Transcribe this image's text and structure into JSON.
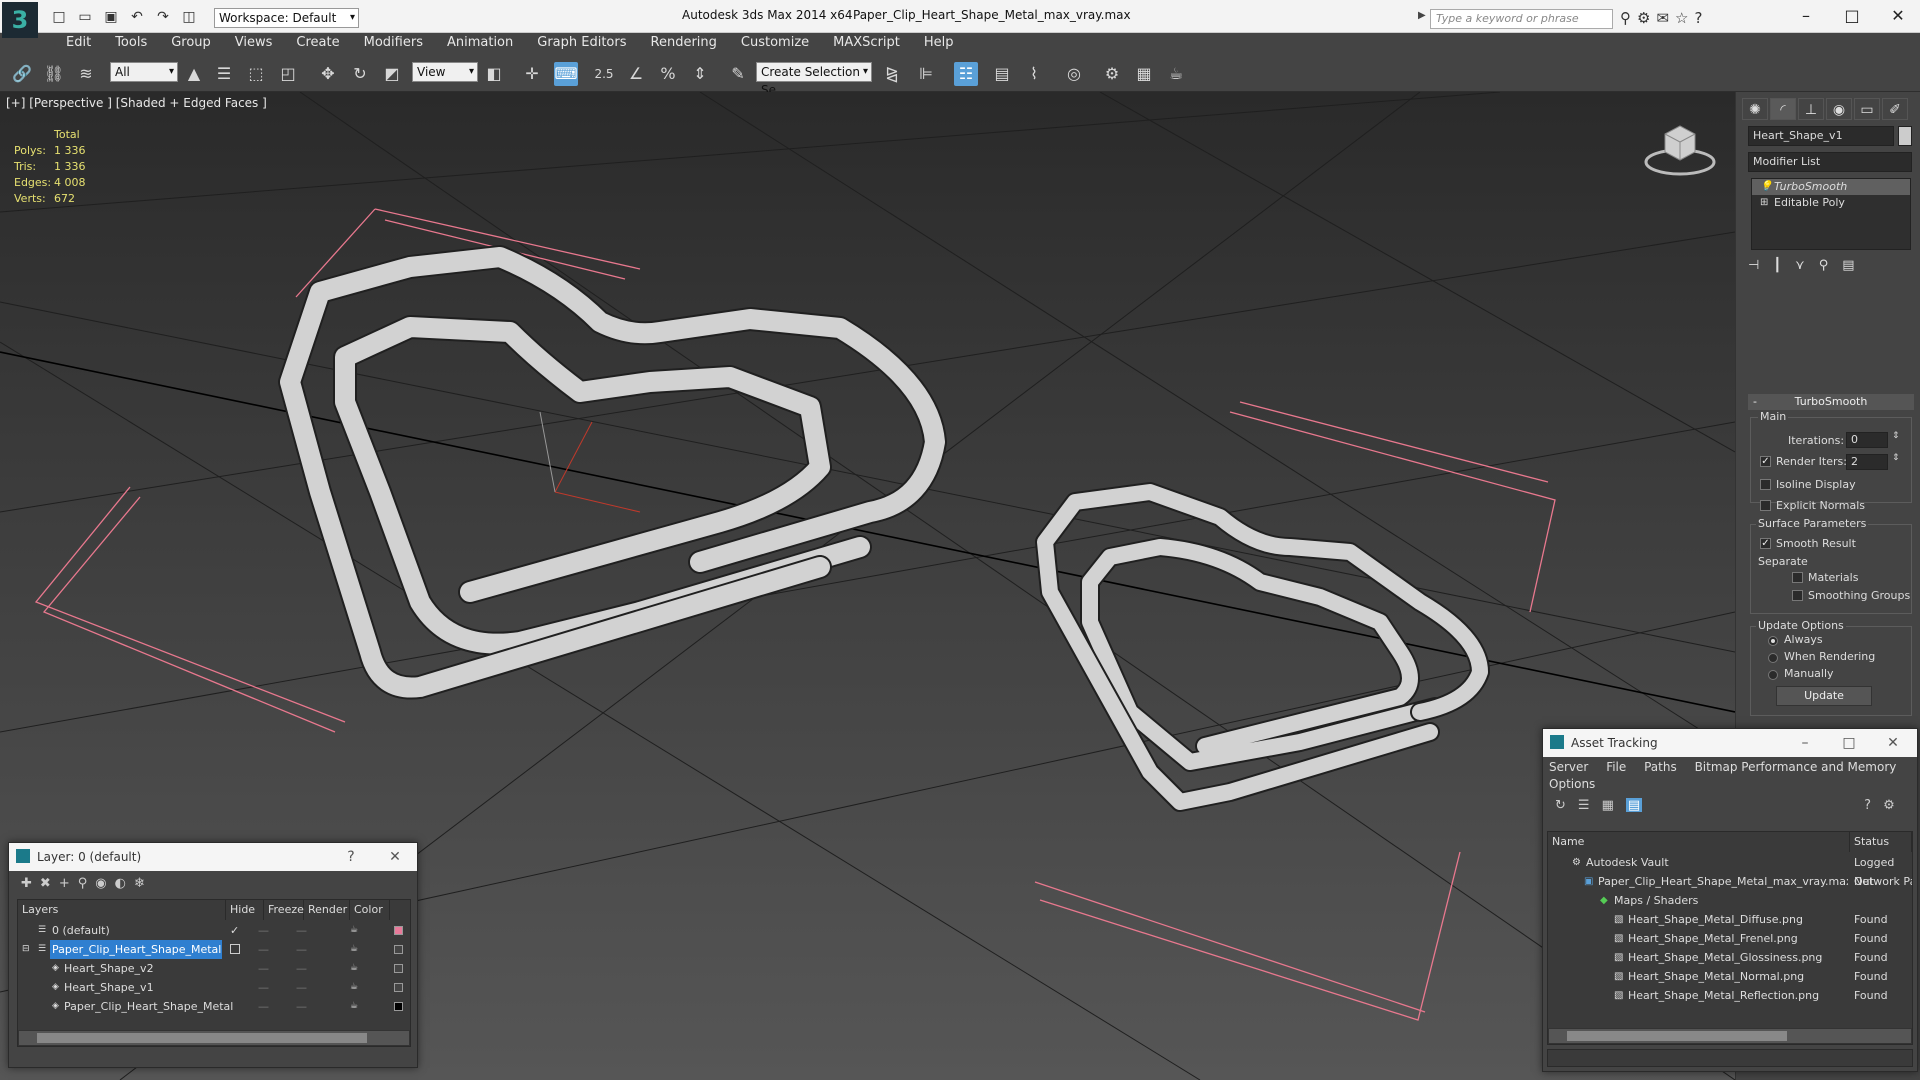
{
  "titlebar": {
    "app_title": "Autodesk 3ds Max  2014 x64",
    "file_name": "Paper_Clip_Heart_Shape_Metal_max_vray.max",
    "workspace": "Workspace: Default",
    "search_placeholder": "Type a keyword or phrase"
  },
  "menu": [
    "Edit",
    "Tools",
    "Group",
    "Views",
    "Create",
    "Modifiers",
    "Animation",
    "Graph Editors",
    "Rendering",
    "Customize",
    "MAXScript",
    "Help"
  ],
  "toolbar": {
    "selection_filter": "All",
    "ref_coord": "View",
    "snap_label": "2.5",
    "selection_set": "Create Selection Se"
  },
  "viewport": {
    "label": "[+] [Perspective ] [Shaded + Edged Faces ]",
    "stats_header": "Total",
    "stats": [
      {
        "k": "Polys:",
        "v": "1 336"
      },
      {
        "k": "Tris:",
        "v": "1 336"
      },
      {
        "k": "Edges:",
        "v": "4 008"
      },
      {
        "k": "Verts:",
        "v": "672"
      }
    ]
  },
  "command_panel": {
    "object_name": "Heart_Shape_v1",
    "modifier_list": "Modifier List",
    "stack": [
      "TurboSmooth",
      "Editable Poly"
    ],
    "rollout_title": "TurboSmooth",
    "main_label": "Main",
    "iterations_label": "Iterations:",
    "iterations_value": "0",
    "render_iters_label": "Render Iters:",
    "render_iters_value": "2",
    "isoline": "Isoline Display",
    "explicit": "Explicit Normals",
    "surface_params": "Surface Parameters",
    "smooth_result": "Smooth Result",
    "separate": "Separate",
    "materials": "Materials",
    "smoothing_groups": "Smoothing Groups",
    "update_options": "Update Options",
    "always": "Always",
    "when_rendering": "When Rendering",
    "manually": "Manually",
    "update_button": "Update"
  },
  "layer_window": {
    "title": "Layer: 0 (default)",
    "help": "?",
    "columns": [
      "Layers",
      "Hide",
      "Freeze",
      "Render",
      "Color"
    ],
    "rows": [
      {
        "name": "0 (default)",
        "color": "#e87a9a",
        "check": "✓"
      },
      {
        "name": "Paper_Clip_Heart_Shape_Metal",
        "color": "#444444",
        "check": ""
      },
      {
        "name": "Heart_Shape_v2",
        "color": "#444444",
        "check": ""
      },
      {
        "name": "Heart_Shape_v1",
        "color": "#444444",
        "check": ""
      },
      {
        "name": "Paper_Clip_Heart_Shape_Metal",
        "color": "#000000",
        "check": ""
      }
    ]
  },
  "asset_window": {
    "title": "Asset Tracking",
    "menu": [
      "Server",
      "File",
      "Paths",
      "Bitmap Performance and Memory",
      "Options"
    ],
    "columns": [
      "Name",
      "Status"
    ],
    "rows": [
      {
        "name": "Autodesk Vault",
        "status": "Logged Out"
      },
      {
        "name": "Paper_Clip_Heart_Shape_Metal_max_vray.max",
        "status": "Network Pa"
      },
      {
        "name": "Maps / Shaders",
        "status": ""
      },
      {
        "name": "Heart_Shape_Metal_Diffuse.png",
        "status": "Found"
      },
      {
        "name": "Heart_Shape_Metal_Frenel.png",
        "status": "Found"
      },
      {
        "name": "Heart_Shape_Metal_Glossiness.png",
        "status": "Found"
      },
      {
        "name": "Heart_Shape_Metal_Normal.png",
        "status": "Found"
      },
      {
        "name": "Heart_Shape_Metal_Reflection.png",
        "status": "Found"
      }
    ]
  },
  "colors": {
    "accent": "#2f7fd0",
    "bbox": "#e8788e",
    "mesh": "#d0d0d0"
  }
}
